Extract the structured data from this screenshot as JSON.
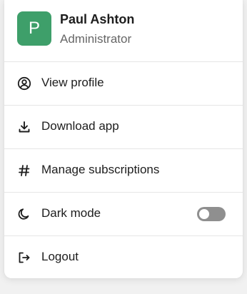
{
  "user": {
    "initial": "P",
    "name": "Paul Ashton",
    "role": "Administrator",
    "avatar_color": "#3e9f6a"
  },
  "menu": {
    "items": [
      {
        "label": "View profile",
        "icon": "user-circle-icon"
      },
      {
        "label": "Download app",
        "icon": "download-icon"
      },
      {
        "label": "Manage subscriptions",
        "icon": "hash-icon"
      },
      {
        "label": "Dark mode",
        "icon": "moon-icon",
        "toggle": "off"
      },
      {
        "label": "Logout",
        "icon": "logout-icon"
      }
    ]
  },
  "colors": {
    "toggle_off": "#8f8f8f",
    "text": "#1d1d1d",
    "muted": "#666666"
  }
}
